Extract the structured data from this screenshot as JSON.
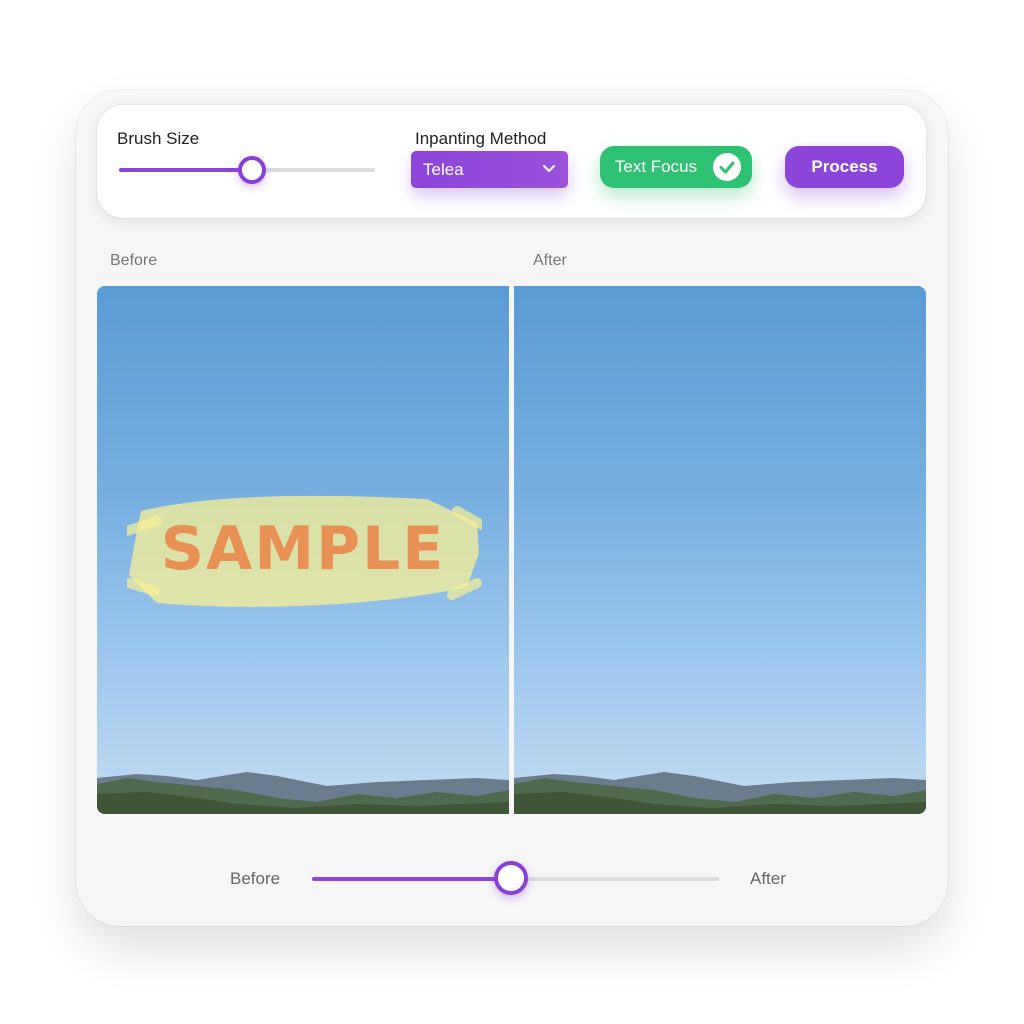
{
  "toolbar": {
    "brush_label": "Brush Size",
    "brush_value_fraction": 0.52,
    "method_label": "Inpanting Method",
    "method_value": "Telea",
    "text_focus_label": "Text Focus",
    "text_focus_checked": true,
    "process_label": "Process"
  },
  "panes": {
    "before_label": "Before",
    "after_label": "After",
    "watermark_text": "SAMPLE"
  },
  "compare": {
    "left_label": "Before",
    "right_label": "After",
    "position_fraction": 0.49
  },
  "colors": {
    "accent": "#8b45d8",
    "success": "#2fc172"
  },
  "icons": {
    "select_chevron": "chevron-down-icon",
    "text_focus_check": "check-circle-icon"
  }
}
